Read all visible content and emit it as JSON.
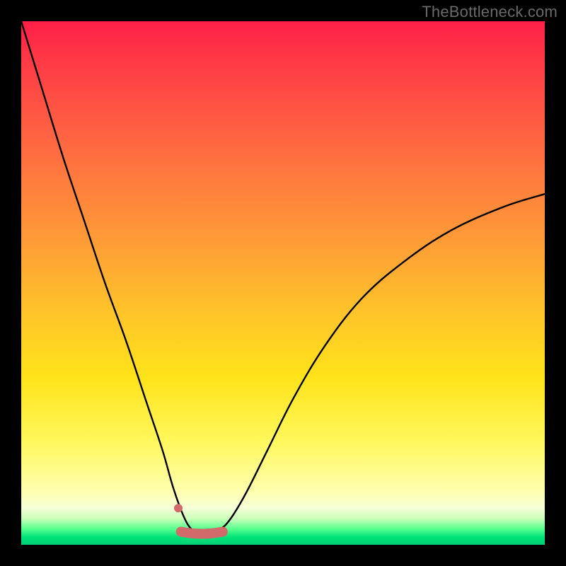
{
  "watermark": "TheBottleneck.com",
  "colors": {
    "page_bg": "#000000",
    "curve": "#000000",
    "marker": "#d16a6a",
    "marker_dot": "#d16a6a"
  },
  "chart_data": {
    "type": "line",
    "title": "",
    "xlabel": "",
    "ylabel": "",
    "xlim": [
      0,
      100
    ],
    "ylim": [
      0,
      100
    ],
    "grid": false,
    "legend": false,
    "series": [
      {
        "name": "bottleneck-curve",
        "x": [
          0,
          4,
          8,
          12,
          16,
          20,
          24,
          27,
          29,
          31,
          32.5,
          34,
          36,
          38,
          40,
          43,
          47,
          52,
          58,
          65,
          73,
          82,
          92,
          100
        ],
        "y": [
          100,
          87,
          74,
          62,
          50,
          39,
          27,
          18,
          11,
          5.5,
          3,
          2.5,
          2.5,
          3,
          5,
          10,
          18,
          28,
          38,
          47,
          54,
          60,
          64.5,
          67
        ]
      }
    ],
    "annotations": [
      {
        "kind": "marker-segment",
        "x0": 30.5,
        "x1": 38.5,
        "y": 2.5
      },
      {
        "kind": "marker-dot",
        "x": 30,
        "y": 7
      }
    ]
  }
}
